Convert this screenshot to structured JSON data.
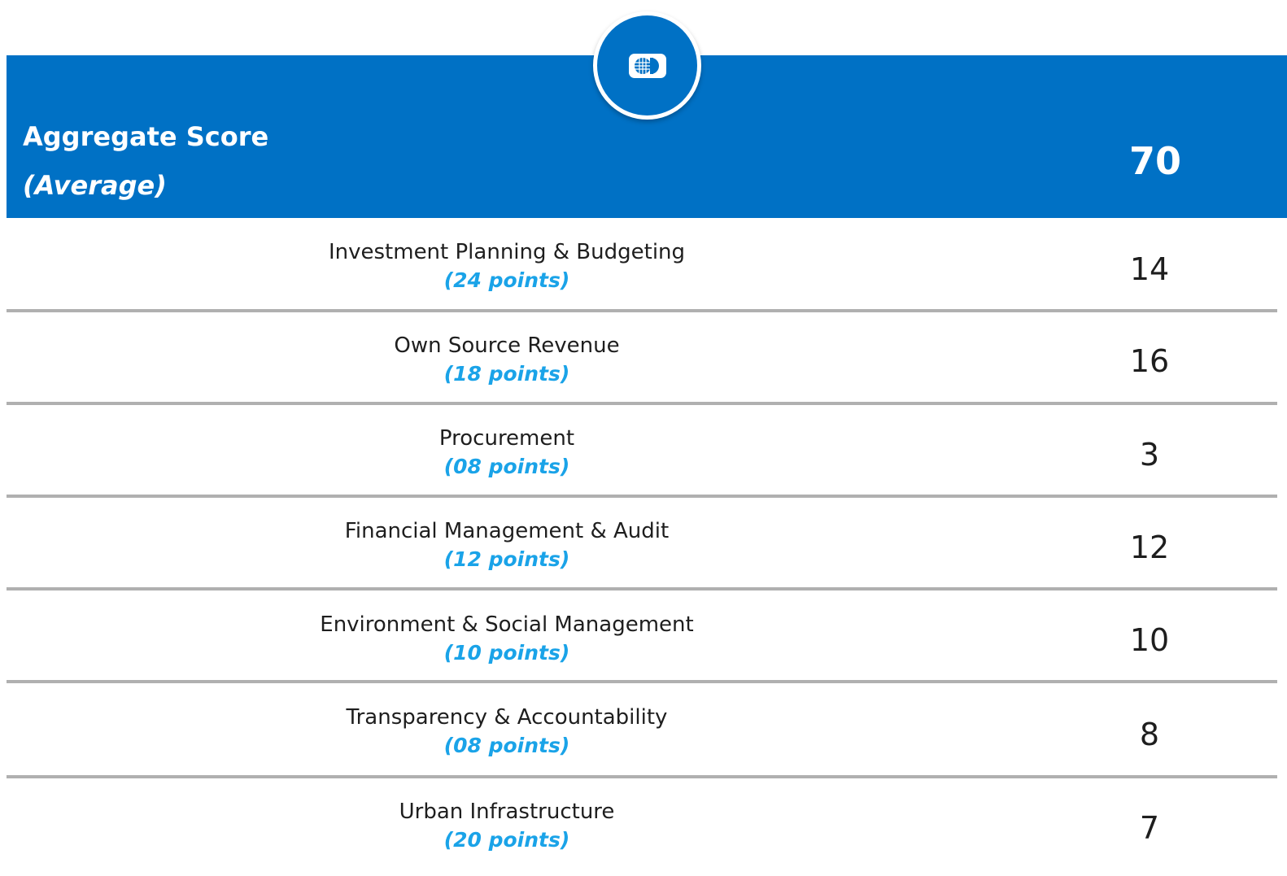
{
  "header": {
    "title": "Aggregate Score",
    "subtitle": "(Average)",
    "score": "70",
    "logo_icon": "globe-logo-icon",
    "band_color": "#0071c5"
  },
  "rows": [
    {
      "name": "Investment Planning & Budgeting",
      "points": "(24 points)",
      "score": "14"
    },
    {
      "name": "Own Source Revenue",
      "points": "(18 points)",
      "score": "16"
    },
    {
      "name": "Procurement",
      "points": "(08 points)",
      "score": "3"
    },
    {
      "name": "Financial Management & Audit",
      "points": "(12 points)",
      "score": "12"
    },
    {
      "name": "Environment & Social Management",
      "points": "(10 points)",
      "score": "10"
    },
    {
      "name": "Transparency & Accountability",
      "points": "(08 points)",
      "score": "8"
    },
    {
      "name": "Urban Infrastructure",
      "points": "(20 points)",
      "score": "7"
    }
  ],
  "colors": {
    "points_text": "#1aa3e8",
    "divider": "#b0b0b0"
  }
}
